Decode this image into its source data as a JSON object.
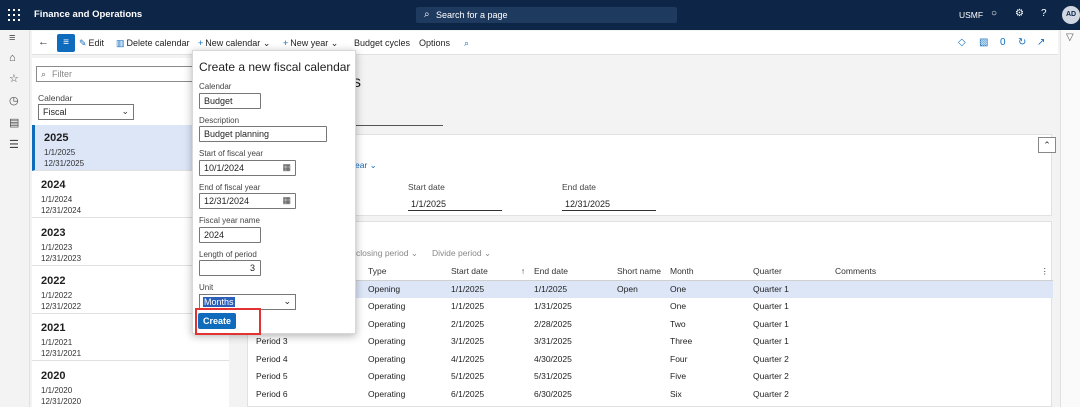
{
  "topbar": {
    "app_title": "Finance and Operations",
    "search_label": "Search for a page",
    "company": "USMF",
    "help": "?",
    "avatar_initials": "AD"
  },
  "icons": {
    "search": "⌕",
    "bell": "○",
    "gear": "⚙",
    "hamburger": "≡",
    "home": "⌂",
    "star": "☆",
    "clock": "◷",
    "workspace": "▤",
    "list": "☰",
    "back": "←",
    "menu": "≡",
    "edit": "✎",
    "delete": "▥",
    "plus": "+",
    "chevron_down": "⌄",
    "chevron_up": "⌃",
    "calendar": "▦",
    "filter": "▽",
    "diamond": "◇",
    "office": "▧",
    "chat": "●",
    "refresh": "↻",
    "popout": "↗",
    "sort": "↑",
    "more": "⋮"
  },
  "toolbar": {
    "edit": "Edit",
    "delete_calendar": "Delete calendar",
    "new_calendar": "New calendar",
    "new_year": "New year",
    "budget_cycles": "Budget cycles",
    "options": "Options",
    "badge_count": "0"
  },
  "filterpane": {
    "filter_placeholder": "Filter",
    "calendar_label": "Calendar",
    "calendar_value": "Fiscal",
    "years": [
      {
        "year": "2025",
        "start": "1/1/2025",
        "end": "12/31/2025"
      },
      {
        "year": "2024",
        "start": "1/1/2024",
        "end": "12/31/2024"
      },
      {
        "year": "2023",
        "start": "1/1/2023",
        "end": "12/31/2023"
      },
      {
        "year": "2022",
        "start": "1/1/2022",
        "end": "12/31/2022"
      },
      {
        "year": "2021",
        "start": "1/1/2021",
        "end": "12/31/2021"
      },
      {
        "year": "2020",
        "start": "1/1/2020",
        "end": "12/31/2020"
      }
    ]
  },
  "main": {
    "heading_fragment": "s",
    "year_link_fragment": "ear",
    "start_date_label": "Start date",
    "start_date_value": "1/1/2025",
    "end_date_label": "End date",
    "end_date_value": "12/31/2025",
    "closing_period_fragment": "closing period",
    "divide_period": "Divide period"
  },
  "grid": {
    "columns": [
      "",
      "Type",
      "Start date",
      "End date",
      "Short name",
      "Month",
      "Quarter",
      "Comments"
    ],
    "rows": [
      {
        "period": "",
        "type": "Opening",
        "start": "1/1/2025",
        "end": "1/1/2025",
        "short": "Open",
        "month": "One",
        "quarter": "Quarter 1"
      },
      {
        "period": "",
        "type": "Operating",
        "start": "1/1/2025",
        "end": "1/31/2025",
        "short": "",
        "month": "One",
        "quarter": "Quarter 1"
      },
      {
        "period": "",
        "type": "Operating",
        "start": "2/1/2025",
        "end": "2/28/2025",
        "short": "",
        "month": "Two",
        "quarter": "Quarter 1"
      },
      {
        "period": "Period 3",
        "type": "Operating",
        "start": "3/1/2025",
        "end": "3/31/2025",
        "short": "",
        "month": "Three",
        "quarter": "Quarter 1"
      },
      {
        "period": "Period 4",
        "type": "Operating",
        "start": "4/1/2025",
        "end": "4/30/2025",
        "short": "",
        "month": "Four",
        "quarter": "Quarter 2"
      },
      {
        "period": "Period 5",
        "type": "Operating",
        "start": "5/1/2025",
        "end": "5/31/2025",
        "short": "",
        "month": "Five",
        "quarter": "Quarter 2"
      },
      {
        "period": "Period 6",
        "type": "Operating",
        "start": "6/1/2025",
        "end": "6/30/2025",
        "short": "",
        "month": "Six",
        "quarter": "Quarter 2"
      }
    ]
  },
  "flyout": {
    "title": "Create a new fiscal calendar",
    "calendar_label": "Calendar",
    "calendar_value": "Budget",
    "description_label": "Description",
    "description_value": "Budget planning",
    "start_label": "Start of fiscal year",
    "start_value": "10/1/2024",
    "end_label": "End of fiscal year",
    "end_value": "12/31/2024",
    "year_name_label": "Fiscal year name",
    "year_name_value": "2024",
    "length_label": "Length of period",
    "length_value": "3",
    "unit_label": "Unit",
    "unit_value": "Months",
    "create": "Create"
  },
  "colors": {
    "topbar": "#0d2647",
    "accent": "#0f6cbd",
    "selected_row": "#dce6f7",
    "highlight": "#e23232"
  }
}
